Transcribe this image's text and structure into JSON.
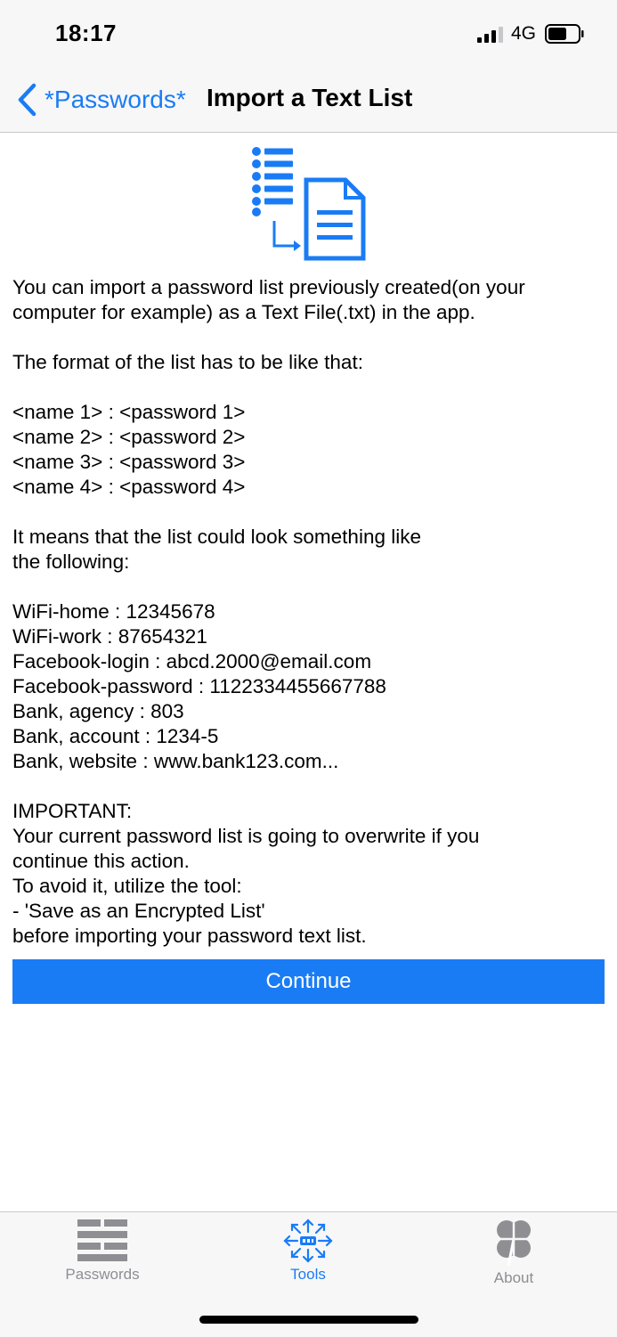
{
  "status": {
    "time": "18:17",
    "network": "4G"
  },
  "nav": {
    "back_label": "*Passwords*",
    "title": "Import a Text List"
  },
  "content": {
    "info_text": "You can import a password list previously created(on your\ncomputer for example) as a Text File(.txt) in the app.\n\nThe format of the list has to be like that:\n\n<name 1> : <password 1>\n<name 2> : <password 2>\n<name 3> : <password 3>\n<name 4> : <password 4>\n\nIt means that the list could look something like\nthe following:\n\nWiFi-home : 12345678\nWiFi-work : 87654321\nFacebook-login : abcd.2000@email.com\nFacebook-password : 1122334455667788\nBank, agency : 803\nBank, account : 1234-5\nBank, website : www.bank123.com...\n\nIMPORTANT:\nYour current password list is going to overwrite if you\ncontinue this action.\nTo avoid it, utilize the tool:\n- 'Save as an Encrypted List'\nbefore importing your password text list.",
    "continue_label": "Continue"
  },
  "tabs": [
    {
      "label": "Passwords",
      "icon": "list-grid-icon",
      "selected": false
    },
    {
      "label": "Tools",
      "icon": "tools-icon",
      "selected": true
    },
    {
      "label": "About",
      "icon": "clover-icon",
      "selected": false
    }
  ],
  "colors": {
    "accent": "#1a7cf5",
    "inactive": "#8e8e93",
    "bar_background": "#f7f7f7"
  },
  "icons": {
    "hero": "import-list-icon"
  }
}
